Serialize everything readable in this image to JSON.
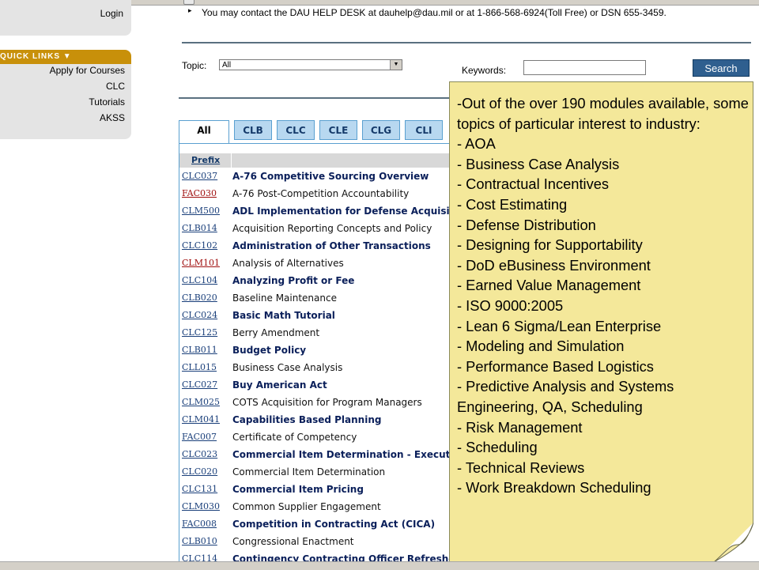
{
  "sidebar": {
    "login_label": "Login",
    "quick_links": {
      "header": "QUICK LINKS ▼",
      "items": [
        "Apply for Courses",
        "CLC",
        "Tutorials",
        "AKSS"
      ]
    }
  },
  "notice": {
    "text": "You may contact the DAU HELP DESK at dauhelp@dau.mil or at 1-866-568-6924(Toll Free) or DSN 655-3459."
  },
  "search": {
    "topic_label": "Topic:",
    "topic_value": "All",
    "keywords_label": "Keywords:",
    "keywords_value": "",
    "button_label": "Search"
  },
  "tabs": [
    "All",
    "CLB",
    "CLC",
    "CLE",
    "CLG",
    "CLI"
  ],
  "table": {
    "header_prefix": "Prefix",
    "rows": [
      {
        "code": "CLC037",
        "title": "A-76 Competitive Sourcing Overview",
        "style": "bold",
        "code_color": "blue"
      },
      {
        "code": "FAC030",
        "title": "A-76 Post-Competition Accountability",
        "style": "norm",
        "code_color": "red"
      },
      {
        "code": "CLM500",
        "title": "ADL Implementation for Defense Acquisition",
        "style": "bold",
        "code_color": "blue"
      },
      {
        "code": "CLB014",
        "title": "Acquisition Reporting Concepts and Policy",
        "style": "norm",
        "code_color": "blue"
      },
      {
        "code": "CLC102",
        "title": "Administration of Other Transactions",
        "style": "bold",
        "code_color": "blue"
      },
      {
        "code": "CLM101",
        "title": "Analysis of Alternatives",
        "style": "norm",
        "code_color": "red"
      },
      {
        "code": "CLC104",
        "title": "Analyzing Profit or Fee",
        "style": "bold",
        "code_color": "blue"
      },
      {
        "code": "CLB020",
        "title": "Baseline Maintenance",
        "style": "norm",
        "code_color": "blue"
      },
      {
        "code": "CLC024",
        "title": "Basic Math Tutorial",
        "style": "bold",
        "code_color": "blue"
      },
      {
        "code": "CLC125",
        "title": "Berry Amendment",
        "style": "norm",
        "code_color": "blue"
      },
      {
        "code": "CLB011",
        "title": "Budget Policy",
        "style": "bold",
        "code_color": "blue"
      },
      {
        "code": "CLL015",
        "title": "Business Case Analysis",
        "style": "norm",
        "code_color": "blue"
      },
      {
        "code": "CLC027",
        "title": "Buy American Act",
        "style": "bold",
        "code_color": "blue"
      },
      {
        "code": "CLM025",
        "title": "COTS Acquisition for Program Managers",
        "style": "norm",
        "code_color": "blue"
      },
      {
        "code": "CLM041",
        "title": "Capabilities Based Planning",
        "style": "bold",
        "code_color": "blue"
      },
      {
        "code": "FAC007",
        "title": "Certificate of Competency",
        "style": "norm",
        "code_color": "blue"
      },
      {
        "code": "CLC023",
        "title": "Commercial Item Determination - Executive",
        "style": "bold",
        "code_color": "blue"
      },
      {
        "code": "CLC020",
        "title": "Commercial Item Determination",
        "style": "norm",
        "code_color": "blue"
      },
      {
        "code": "CLC131",
        "title": "Commercial Item Pricing",
        "style": "bold",
        "code_color": "blue"
      },
      {
        "code": "CLM030",
        "title": "Common Supplier Engagement",
        "style": "norm",
        "code_color": "blue"
      },
      {
        "code": "FAC008",
        "title": "Competition in Contracting Act (CICA)",
        "style": "bold",
        "code_color": "blue"
      },
      {
        "code": "CLB010",
        "title": "Congressional Enactment",
        "style": "norm",
        "code_color": "blue"
      },
      {
        "code": "CLC114",
        "title": "Contingency Contracting Officer Refresher",
        "style": "bold",
        "code_color": "blue"
      }
    ]
  },
  "sticky_note": {
    "lines": [
      "-Out of the over 190 modules available, some topics of particular interest to industry:",
      "- AOA",
      "- Business Case Analysis",
      "- Contractual Incentives",
      "- Cost Estimating",
      "- Defense Distribution",
      "- Designing for Supportability",
      "- DoD eBusiness Environment",
      "- Earned Value Management",
      "- ISO 9000:2005",
      "- Lean 6 Sigma/Lean Enterprise",
      "- Modeling and Simulation",
      "- Performance Based Logistics",
      "- Predictive Analysis and Systems Engineering, QA, Scheduling",
      "- Risk Management",
      "- Scheduling",
      "- Technical Reviews",
      "- Work Breakdown Scheduling"
    ]
  },
  "colors": {
    "tab_bg": "#b8d8f0",
    "quick_links_header": "#c8900a",
    "search_button": "#2f5f8f",
    "note_bg": "#f4e89a",
    "link_blue": "#1a3f7a",
    "link_red": "#a01010"
  }
}
